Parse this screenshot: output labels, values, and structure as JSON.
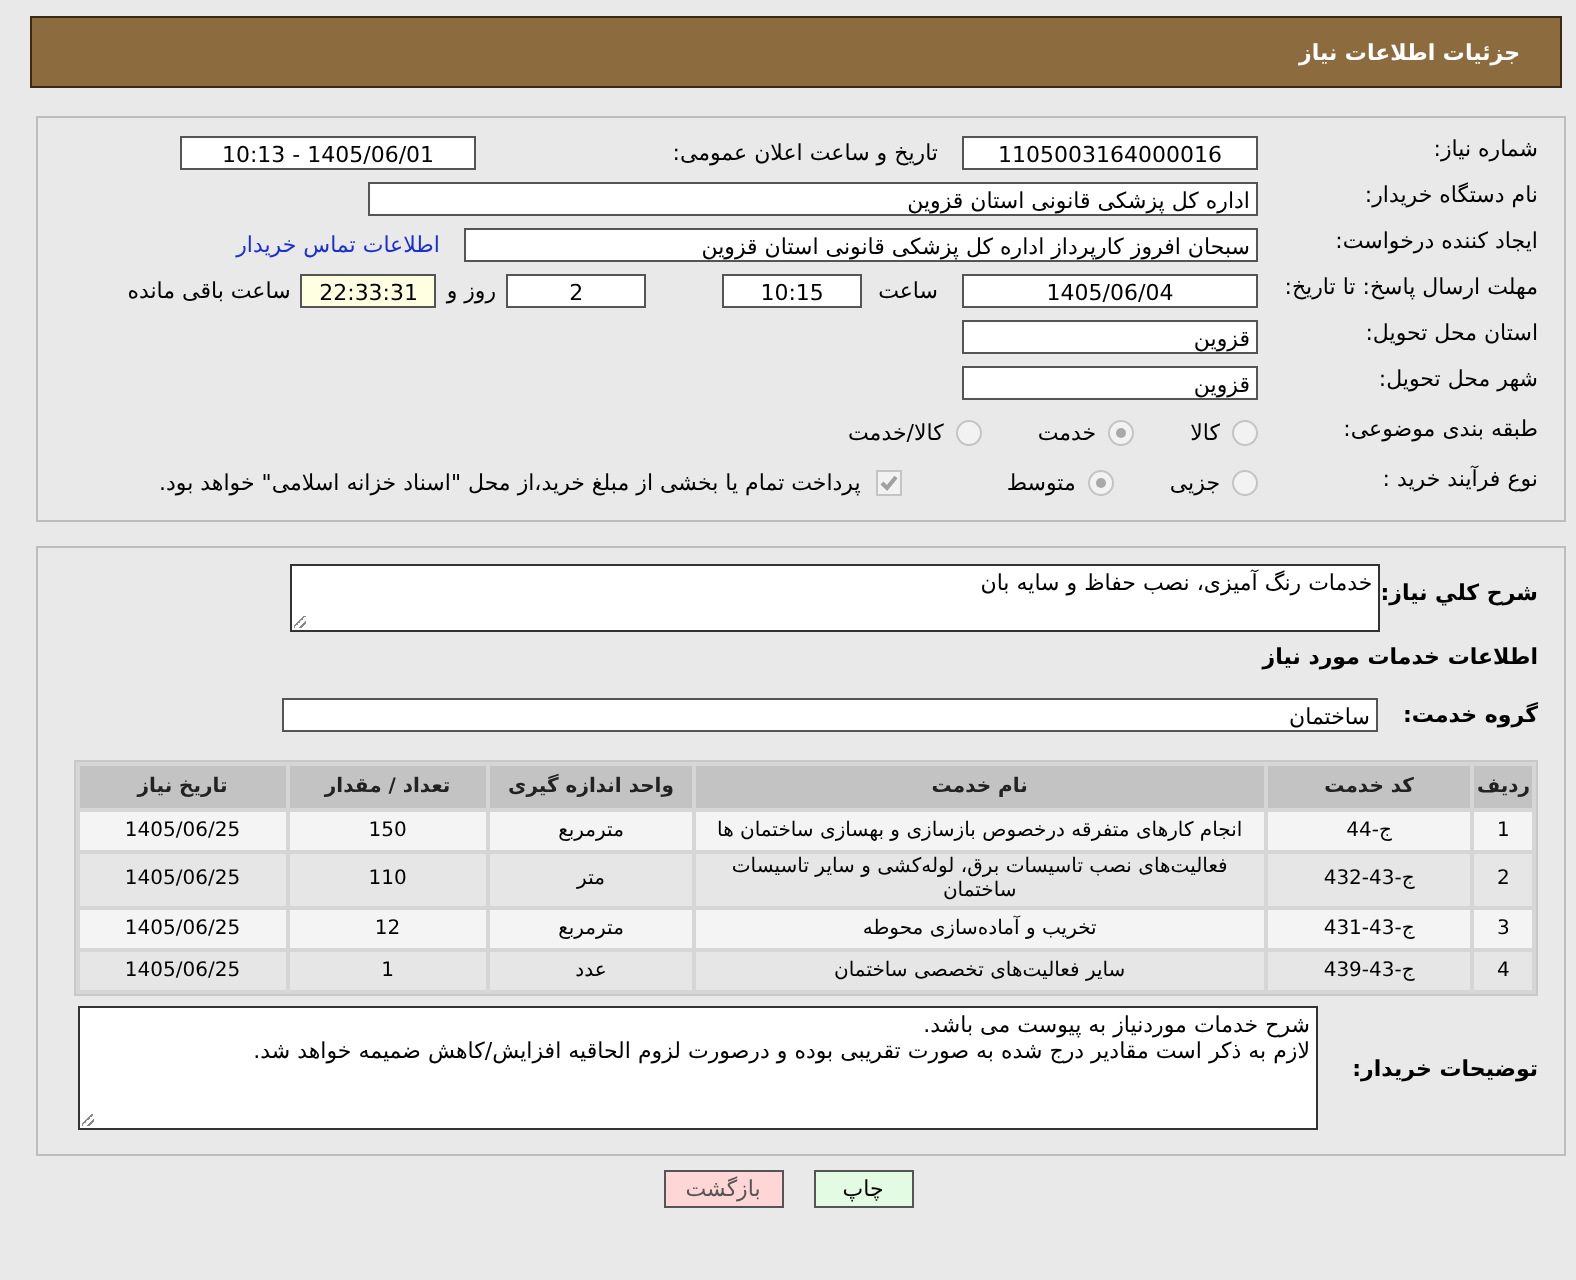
{
  "header": {
    "title": "جزئیات اطلاعات نیاز"
  },
  "need_number": {
    "label": "شماره نیاز:",
    "value": "1105003164000016"
  },
  "announce": {
    "label": "تاریخ و ساعت اعلان عمومی:",
    "value": "1405/06/01 - 10:13"
  },
  "buyer_org": {
    "label": "نام دستگاه خریدار:",
    "value": "اداره کل پزشکی قانونی استان قزوین"
  },
  "requester": {
    "label": "ایجاد کننده درخواست:",
    "value": "سبحان افروز کارپرداز اداره کل پزشکی قانونی استان قزوین",
    "link": "اطلاعات تماس خریدار"
  },
  "deadline": {
    "label": "مهلت ارسال پاسخ: تا تاریخ:",
    "date": "1405/06/04",
    "time_label": "ساعت",
    "time": "10:15",
    "days": "2",
    "days_label": "روز و",
    "remaining": "22:33:31",
    "remaining_label": "ساعت باقی مانده"
  },
  "province": {
    "label": "استان محل تحویل:",
    "value": "قزوین"
  },
  "city": {
    "label": "شهر محل تحویل:",
    "value": "قزوین"
  },
  "category": {
    "label": "طبقه بندی موضوعی:",
    "options": [
      {
        "label": "کالا",
        "selected": false
      },
      {
        "label": "خدمت",
        "selected": true
      },
      {
        "label": "کالا/خدمت",
        "selected": false
      }
    ]
  },
  "process": {
    "label": "نوع فرآیند خرید :",
    "options": [
      {
        "label": "جزیی",
        "selected": false
      },
      {
        "label": "متوسط",
        "selected": true
      }
    ],
    "payment": {
      "checked": true,
      "label": "پرداخت تمام یا بخشی از مبلغ خرید،از محل \"اسناد خزانه اسلامی\" خواهد بود."
    }
  },
  "description": {
    "label": "شرح کلي نياز:",
    "value": "خدمات رنگ آمیزی، نصب حفاظ و سایه بان"
  },
  "services_title": "اطلاعات خدمات مورد نیاز",
  "service_group": {
    "label": "گروه خدمت:",
    "value": "ساختمان"
  },
  "table": {
    "columns": [
      "ردیف",
      "کد خدمت",
      "نام خدمت",
      "واحد اندازه گیری",
      "تعداد / مقدار",
      "تاریخ نیاز"
    ],
    "rows": [
      [
        "1",
        "ج-44",
        "انجام کارهای متفرقه درخصوص بازسازی و بهسازی ساختمان ها",
        "مترمربع",
        "150",
        "1405/06/25"
      ],
      [
        "2",
        "ج-43-432",
        "فعالیت‌های نصب تاسیسات برق، لوله‌کشی و سایر تاسیسات ساختمان",
        "متر",
        "110",
        "1405/06/25"
      ],
      [
        "3",
        "ج-43-431",
        "تخریب و آماده‌سازی محوطه",
        "مترمربع",
        "12",
        "1405/06/25"
      ],
      [
        "4",
        "ج-43-439",
        "سایر فعالیت‌های تخصصی ساختمان",
        "عدد",
        "1",
        "1405/06/25"
      ]
    ]
  },
  "buyer_notes": {
    "label": "توضیحات خریدار:",
    "lines": [
      "شرح خدمات موردنیاز به پیوست می باشد.",
      "لازم به ذکر است مقادیر درج شده به صورت تقریبی بوده و درصورت لزوم الحاقیه افزایش/کاهش ضمیمه خواهد شد."
    ]
  },
  "buttons": [
    {
      "kind": "print",
      "label": "چاپ"
    },
    {
      "kind": "back",
      "label": "بازگشت"
    }
  ]
}
